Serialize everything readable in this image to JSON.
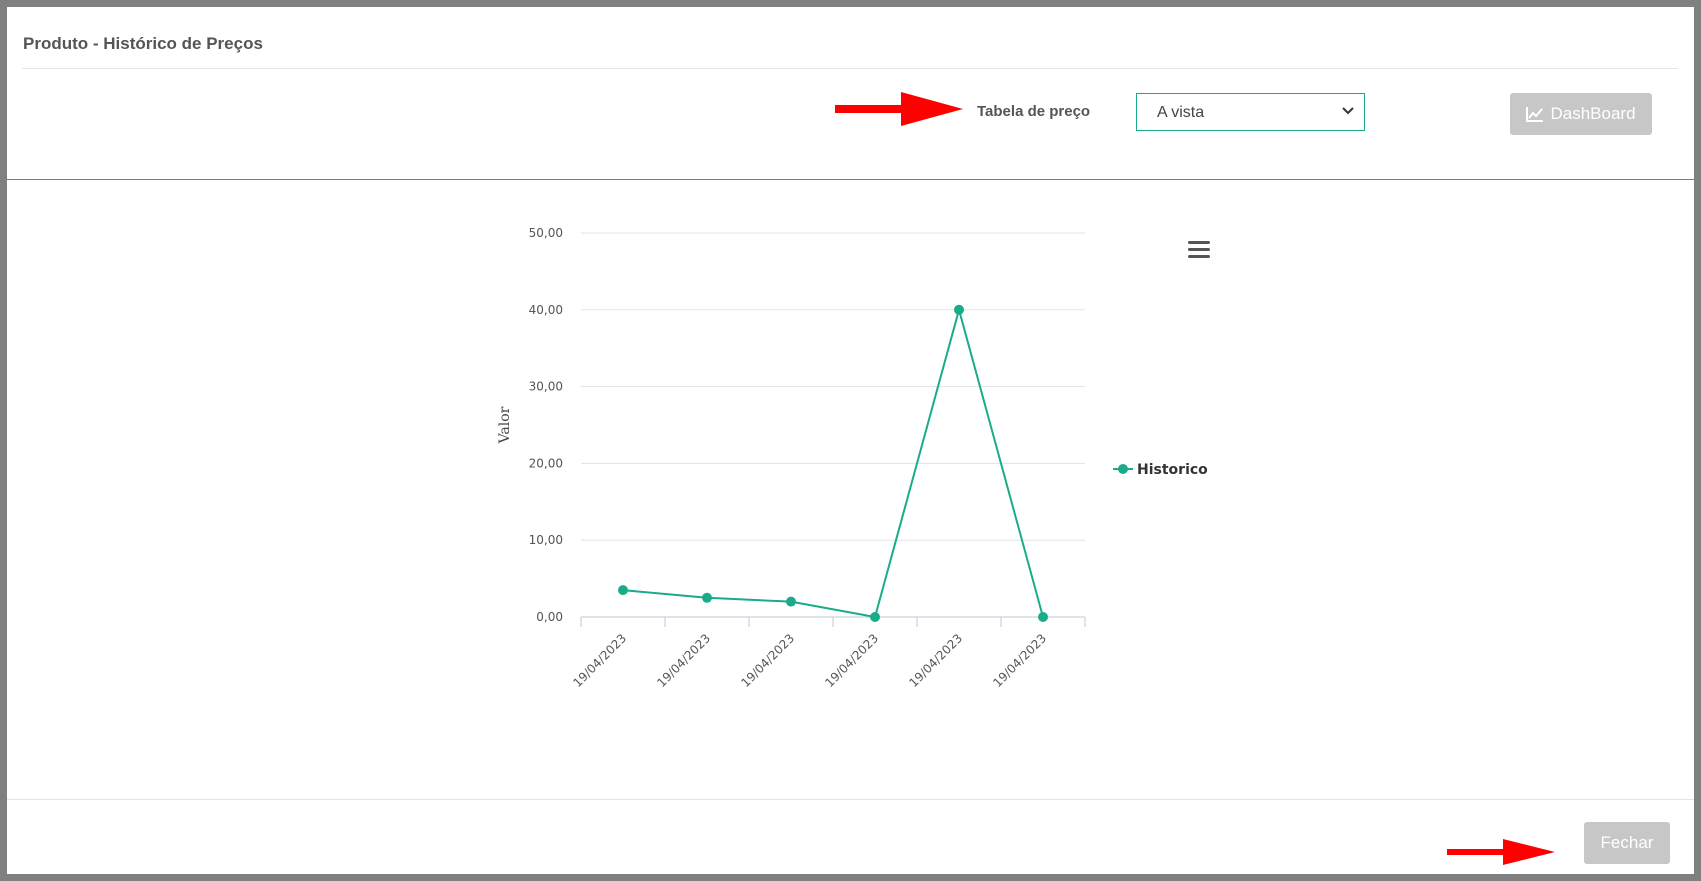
{
  "modal": {
    "title": "Produto - Histórico de Preços"
  },
  "filter": {
    "label": "Tabela de preço",
    "selected": "A vista"
  },
  "toolbar": {
    "dashboard_label": "DashBoard",
    "close_label": "Fechar"
  },
  "colors": {
    "accent": "#1aab8a",
    "button_disabled": "#c7c7c7",
    "annotation_arrow": "#ff0000"
  },
  "icons": {
    "chart_menu": "hamburger-menu-icon",
    "dashboard": "line-chart-icon"
  },
  "chart_data": {
    "type": "line",
    "categories": [
      "19/04/2023",
      "19/04/2023",
      "19/04/2023",
      "19/04/2023",
      "19/04/2023",
      "19/04/2023"
    ],
    "series": [
      {
        "name": "Historico",
        "values": [
          3.5,
          2.5,
          2.0,
          0.0,
          40.0,
          0.0
        ]
      }
    ],
    "ylabel": "Valor",
    "ylim": [
      0,
      50
    ],
    "yticks": [
      "0,00",
      "10,00",
      "20,00",
      "30,00",
      "40,00",
      "50,00"
    ],
    "grid": true,
    "legend": "right"
  }
}
